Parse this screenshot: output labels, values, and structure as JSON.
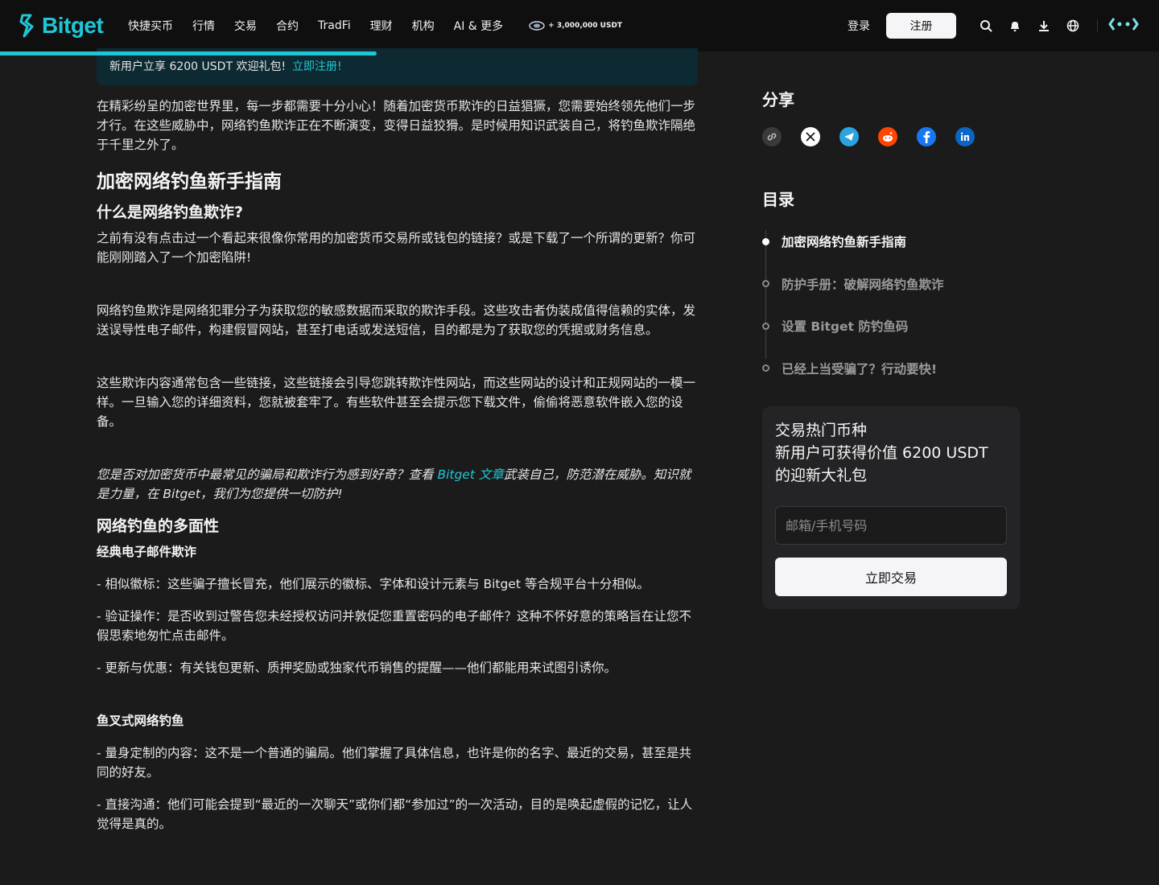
{
  "header": {
    "logo_text": "Bitget",
    "nav": [
      "快捷买币",
      "行情",
      "交易",
      "合约",
      "TradFi",
      "理财",
      "机构",
      "AI & 更多"
    ],
    "promo_text": "+ 3,000,000 USDT",
    "login_label": "登录",
    "register_label": "注册",
    "icons": [
      "search-icon",
      "bell-icon",
      "download-icon",
      "globe-icon",
      "bitget-wallet-icon"
    ],
    "accent_color": "#1fc7d4"
  },
  "reading_progress_percent": 32.5,
  "banner": {
    "text": "新用户立享 6200 USDT 欢迎礼包!",
    "link": "立即注册!"
  },
  "article": {
    "intro": "在精彩纷呈的加密世界里，每一步都需要十分小心！随着加密货币欺诈的日益猖獗，您需要始终领先他们一步才行。在这些威胁中，网络钓鱼欺诈正在不断演变，变得日益狡猾。是时候用知识武装自己，将钓鱼欺诈隔绝于千里之外了。",
    "h2_guide": "加密网络钓鱼新手指南",
    "h3_what": "什么是网络钓鱼欺诈?",
    "p_what1": "之前有没有点击过一个看起来很像你常用的加密货币交易所或钱包的链接？或是下载了一个所谓的更新？你可能刚刚踏入了一个加密陷阱!",
    "p_what2": "网络钓鱼欺诈是网络犯罪分子为获取您的敏感数据而采取的欺诈手段。这些攻击者伪装成值得信赖的实体，发送误导性电子邮件，构建假冒网站，甚至打电话或发送短信，目的都是为了获取您的凭据或财务信息。",
    "p_what3": "这些欺诈内容通常包含一些链接，这些链接会引导您跳转欺诈性网站，而这些网站的设计和正规网站的一模一样。一旦输入您的详细资料，您就被套牢了。有些软件甚至会提示您下载文件，偷偷将恶意软件嵌入您的设备。",
    "italic_pre": "您是否对加密货币中最常见的骗局和欺诈行为感到好奇？查看 ",
    "italic_link": "Bitget 文章",
    "italic_post": "武装自己，防范潜在威胁。知识就是力量，在 Bitget，我们为您提供一切防护!",
    "h3_faces": "网络钓鱼的多面性",
    "h4_email": "经典电子邮件欺诈",
    "email_points": [
      "- 相似徽标：这些骗子擅长冒充，他们展示的徽标、字体和设计元素与 Bitget 等合规平台十分相似。",
      "- 验证操作：是否收到过警告您未经授权访问并敦促您重置密码的电子邮件？这种不怀好意的策略旨在让您不假思索地匆忙点击邮件。",
      "- 更新与优惠：有关钱包更新、质押奖励或独家代币销售的提醒——他们都能用来试图引诱你。"
    ],
    "h4_spear": "鱼叉式网络钓鱼",
    "spear_points": [
      "- 量身定制的内容：这不是一个普通的骗局。他们掌握了具体信息，也许是你的名字、最近的交易，甚至是共同的好友。",
      "- 直接沟通：他们可能会提到“最近的一次聊天”或你们都“参加过”的一次活动，目的是唤起虚假的记忆，让人觉得是真的。"
    ]
  },
  "sidebar": {
    "share_title": "分享",
    "share_icons": [
      "link-icon",
      "x-icon",
      "telegram-icon",
      "reddit-icon",
      "facebook-icon",
      "linkedin-icon"
    ],
    "share_colors": {
      "telegram": "#2aa3df",
      "reddit": "#ff4500",
      "facebook": "#1877f2",
      "linkedin": "#0a66c2"
    },
    "toc_title": "目录",
    "toc": [
      {
        "label": "加密网络钓鱼新手指南",
        "active": true
      },
      {
        "label": "防护手册：破解网络钓鱼欺诈",
        "active": false
      },
      {
        "label": "设置 Bitget 防钓鱼码",
        "active": false
      },
      {
        "label": "已经上当受骗了？行动要快!",
        "active": false
      }
    ]
  },
  "card": {
    "title_line1": "交易热门币种",
    "title_line2": "新用户可获得价值 6200 USDT",
    "title_line3": "的迎新大礼包",
    "input_placeholder": "邮箱/手机号码",
    "button_label": "立即交易"
  }
}
